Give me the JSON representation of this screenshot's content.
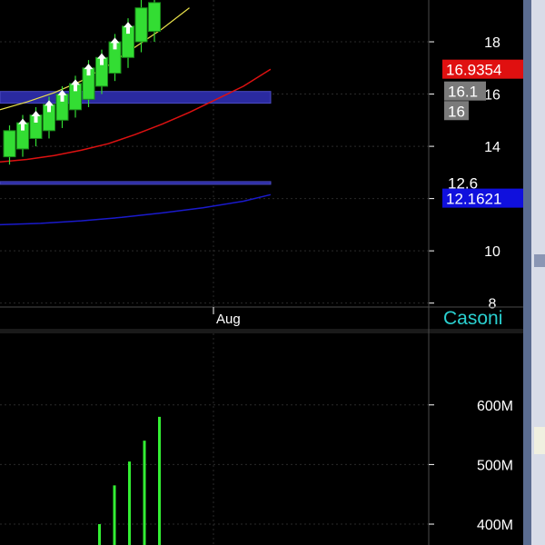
{
  "colors": {
    "background": "#000000",
    "grid": "#2a2a2a",
    "axis_text": "#ffffff",
    "candle_up": "#33dd33",
    "arrow": "#ffffff",
    "ma_fast": "#e8e04a",
    "ma_mid": "#dd1111",
    "ma_slow": "#1a1acc",
    "band": "#2a2aa0",
    "volume": "#33ee33",
    "label_red": "#e01010",
    "label_gray": "#7a7a7a",
    "label_blue": "#1010dd",
    "watermark": "#2ad0d0",
    "right_panel": "#d8dce8"
  },
  "chart_data": [
    {
      "type": "candlestick",
      "title": "",
      "xlabel": "",
      "ylabel": "",
      "x_ticks": [
        "Aug"
      ],
      "y_ticks": [
        8,
        10,
        12,
        14,
        16,
        18
      ],
      "ylim": [
        7.85,
        19.6
      ],
      "grid": true,
      "watermark": "Casoni",
      "candles": [
        {
          "open": 13.6,
          "high": 14.8,
          "low": 13.3,
          "close": 14.6,
          "arrow": false
        },
        {
          "open": 13.9,
          "high": 15.2,
          "low": 13.6,
          "close": 14.9,
          "arrow": true
        },
        {
          "open": 14.3,
          "high": 15.5,
          "low": 14.0,
          "close": 15.2,
          "arrow": true
        },
        {
          "open": 14.6,
          "high": 15.9,
          "low": 14.3,
          "close": 15.6,
          "arrow": true
        },
        {
          "open": 15.0,
          "high": 16.3,
          "low": 14.7,
          "close": 16.0,
          "arrow": true
        },
        {
          "open": 15.4,
          "high": 16.7,
          "low": 15.1,
          "close": 16.4,
          "arrow": true
        },
        {
          "open": 15.8,
          "high": 17.3,
          "low": 15.5,
          "close": 17.0,
          "arrow": true
        },
        {
          "open": 16.3,
          "high": 17.7,
          "low": 16.0,
          "close": 17.4,
          "arrow": true
        },
        {
          "open": 16.8,
          "high": 18.3,
          "low": 16.5,
          "close": 18.0,
          "arrow": true
        },
        {
          "open": 17.4,
          "high": 18.9,
          "low": 17.0,
          "close": 18.6,
          "arrow": true
        },
        {
          "open": 18.0,
          "high": 19.6,
          "low": 17.6,
          "close": 19.3,
          "arrow": false
        },
        {
          "open": 18.4,
          "high": 19.6,
          "low": 18.0,
          "close": 19.5,
          "arrow": false
        }
      ],
      "series": [
        {
          "values": [
            [
              0,
              15.4
            ],
            [
              20,
              15.7
            ],
            [
              40,
              16.05
            ],
            [
              60,
              16.5
            ],
            [
              80,
              17.1
            ],
            [
              100,
              17.8
            ],
            [
              120,
              18.5
            ],
            [
              140,
              19.3
            ]
          ]
        },
        {
          "values": [
            [
              0,
              13.4
            ],
            [
              20,
              13.5
            ],
            [
              40,
              13.65
            ],
            [
              60,
              13.85
            ],
            [
              80,
              14.1
            ],
            [
              100,
              14.45
            ],
            [
              120,
              14.85
            ],
            [
              140,
              15.3
            ],
            [
              160,
              15.8
            ],
            [
              180,
              16.3
            ],
            [
              200,
              16.95
            ]
          ]
        },
        {
          "values": [
            [
              0,
              11.0
            ],
            [
              30,
              11.05
            ],
            [
              60,
              11.15
            ],
            [
              90,
              11.28
            ],
            [
              120,
              11.45
            ],
            [
              150,
              11.65
            ],
            [
              180,
              11.9
            ],
            [
              200,
              12.15
            ]
          ]
        }
      ],
      "bands": [
        {
          "from": 15.65,
          "to": 16.1
        },
        {
          "from": 12.55,
          "to": 12.65
        }
      ],
      "price_labels": [
        {
          "text": "16.9354",
          "value": 16.9354,
          "color": "#e01010"
        },
        {
          "text": "16.1",
          "value": 16.1,
          "color": "#7a7a7a"
        },
        {
          "text": "16",
          "value": 15.35,
          "color": "#7a7a7a"
        },
        {
          "text": "12.6",
          "value": 12.6,
          "color": "none"
        },
        {
          "text": "12.1621",
          "value": 12.0,
          "color": "#1010dd"
        }
      ]
    },
    {
      "type": "bar",
      "title": "",
      "xlabel": "",
      "ylabel": "",
      "y_ticks": [
        "400M",
        "500M",
        "600M"
      ],
      "y_tick_values": [
        400,
        500,
        600
      ],
      "ylim": [
        365,
        720
      ],
      "grid": true,
      "values": [
        400,
        465,
        505,
        540,
        580
      ]
    }
  ]
}
